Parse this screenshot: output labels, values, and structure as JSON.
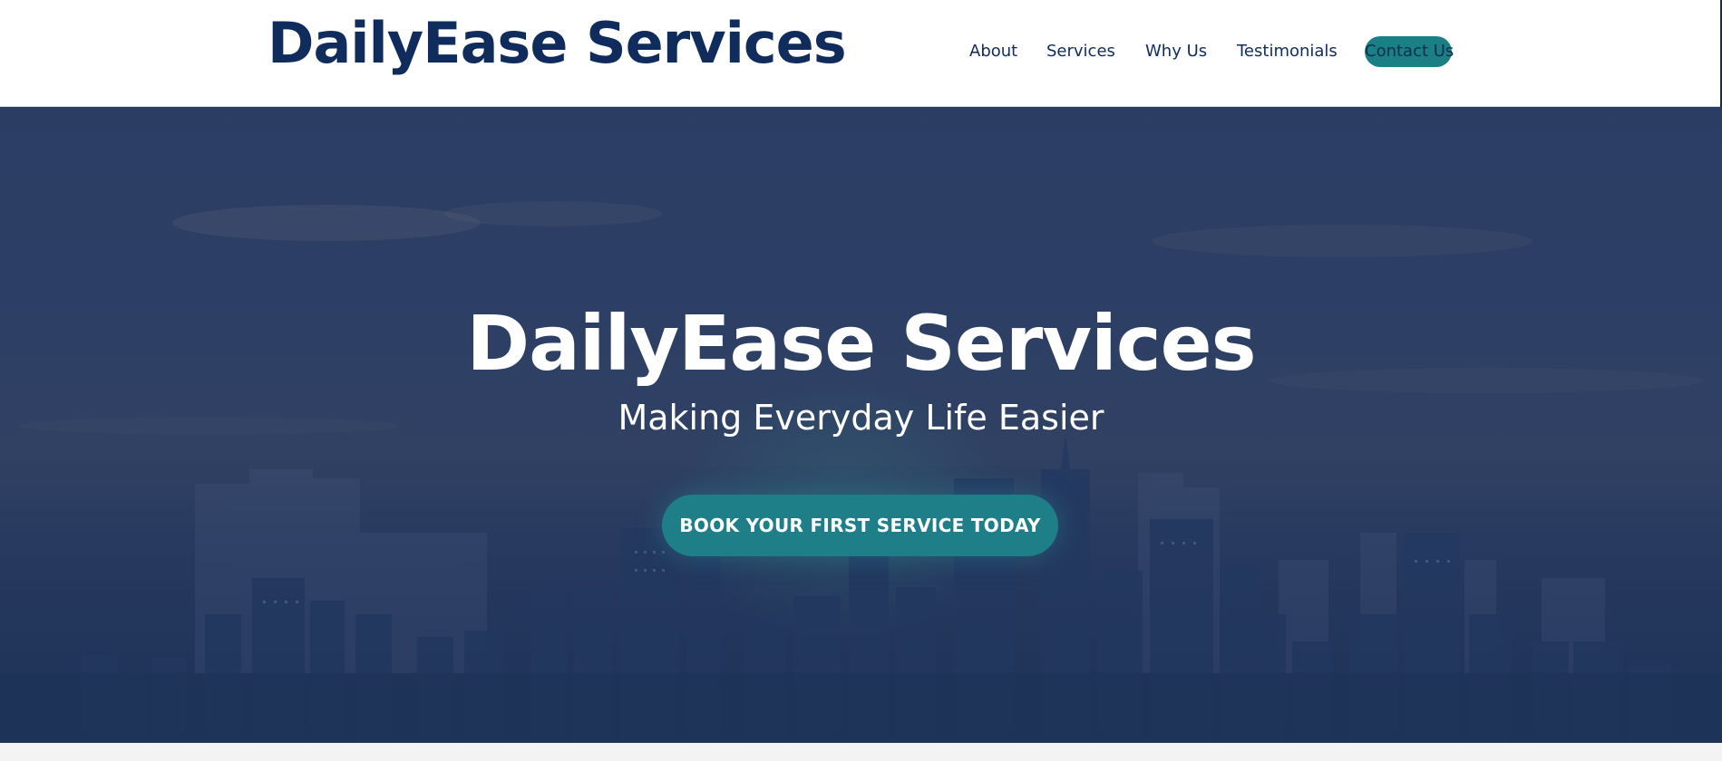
{
  "header": {
    "brand": "DailyEase Services",
    "nav": {
      "about": "About",
      "services": "Services",
      "why_us": "Why Us",
      "testimonials": "Testimonials",
      "contact": "Contact Us"
    }
  },
  "hero": {
    "title": "DailyEase Services",
    "subtitle": "Making Everyday Life Easier",
    "cta_label": "BOOK YOUR FIRST SERVICE TODAY"
  },
  "colors": {
    "brand_navy": "#102c5c",
    "accent_teal": "#1f7f88",
    "hero_overlay": "#2b3d63"
  }
}
